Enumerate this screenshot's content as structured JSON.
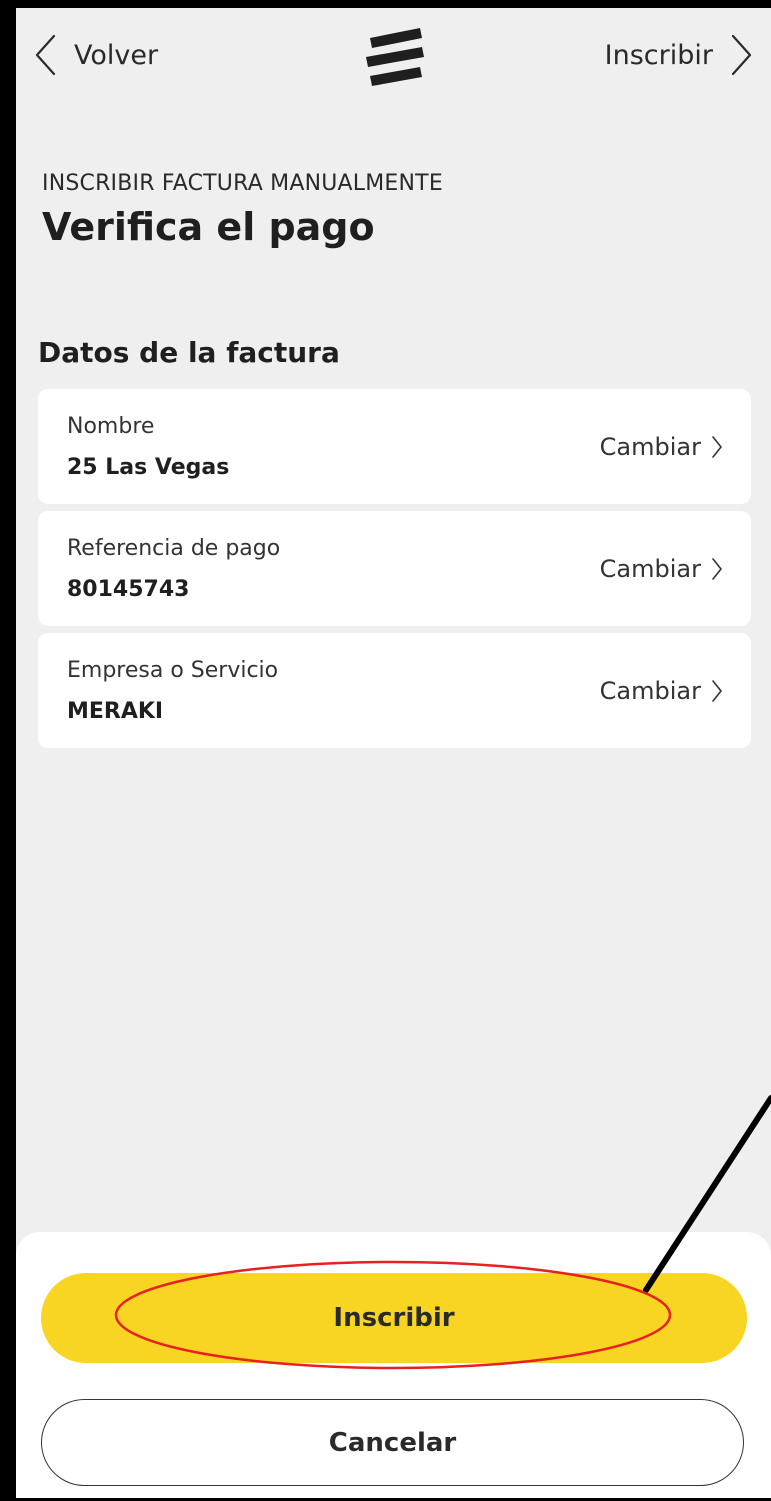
{
  "nav": {
    "back_label": "Volver",
    "next_label": "Inscribir"
  },
  "header": {
    "kicker": "INSCRIBIR FACTURA MANUALMENTE",
    "title": "Verifica el pago"
  },
  "section": {
    "title": "Datos de la factura"
  },
  "cards": [
    {
      "label": "Nombre",
      "value": "25 Las Vegas",
      "action": "Cambiar"
    },
    {
      "label": "Referencia de pago",
      "value": "80145743",
      "action": "Cambiar"
    },
    {
      "label": "Empresa o Servicio",
      "value": "MERAKI",
      "action": "Cambiar"
    }
  ],
  "actions": {
    "primary_label": "Inscribir",
    "secondary_label": "Cancelar"
  },
  "colors": {
    "accent_yellow": "#f9d523",
    "background": "#efefef",
    "annotation_red": "#e8201e"
  },
  "icons": {
    "back": "chevron-left-icon",
    "next": "chevron-right-icon",
    "logo": "bank-logo-icon",
    "card_action": "chevron-right-icon"
  }
}
